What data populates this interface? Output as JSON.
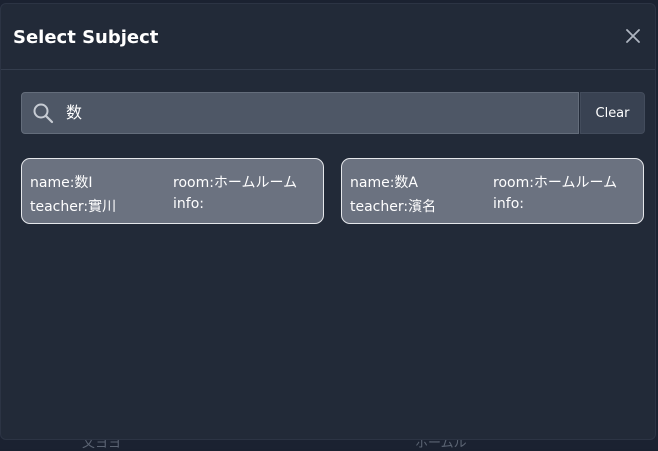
{
  "dialog": {
    "title": "Select Subject",
    "close_icon": "close-icon"
  },
  "search": {
    "value": "数",
    "icon": "search-icon",
    "clear_label": "Clear"
  },
  "subjects": [
    {
      "name": "name:数Ⅰ",
      "room": "room:ホームルーム",
      "teacher": "teacher:實川",
      "info": "info:"
    },
    {
      "name": "name:数A",
      "room": "room:ホームルーム",
      "teacher": "teacher:濱名",
      "info": "info:"
    }
  ],
  "background": {
    "left_text": "文ヨヨ",
    "right_text": "ホームル"
  },
  "colors": {
    "modal_bg": "#222a38",
    "card_bg": "#6b7280",
    "search_bg": "#4e5766",
    "clear_bg": "#394252"
  }
}
